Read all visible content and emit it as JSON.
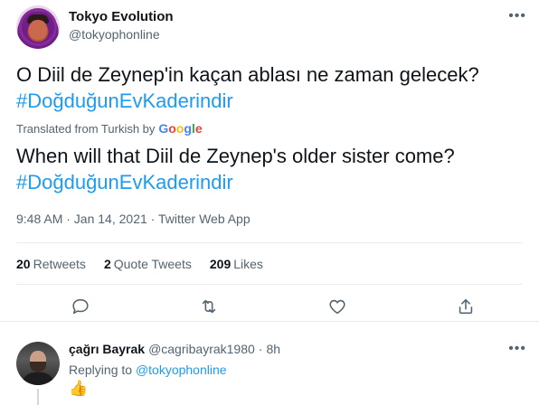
{
  "tweet": {
    "author_name": "Tokyo Evolution",
    "author_handle": "@tokyophonline",
    "more_icon": "more-horizontal-icon",
    "original_text": "O Diil de Zeynep'in kaçan ablası ne zaman gelecek?",
    "original_hashtag": "#DoğduğunEvKaderindir",
    "translated_from": "Translated from Turkish by",
    "translator": "Google",
    "translated_text": "When will that Diil de Zeynep's older sister come?",
    "translated_hashtag": "#DoğduğunEvKaderindir",
    "meta": "9:48 AM · Jan 14, 2021 · Twitter Web App",
    "stats": {
      "retweets_count": "20",
      "retweets_label": "Retweets",
      "quotes_count": "2",
      "quotes_label": "Quote Tweets",
      "likes_count": "209",
      "likes_label": "Likes"
    },
    "actions": [
      "reply-icon",
      "retweet-icon",
      "like-icon",
      "share-icon"
    ]
  },
  "reply": {
    "name": "çağrı Bayrak",
    "handle": "@cagribayrak1980",
    "separator": "·",
    "time": "8h",
    "replying_label": "Replying to",
    "replying_to": "@tokyophonline",
    "content_emoji": "thumbs-up-emoji",
    "more_icon": "more-horizontal-icon"
  },
  "colors": {
    "accent": "#1d9bf0",
    "secondary_text": "#536471",
    "primary_text": "#0f1419",
    "divider": "#e6ecf0"
  }
}
